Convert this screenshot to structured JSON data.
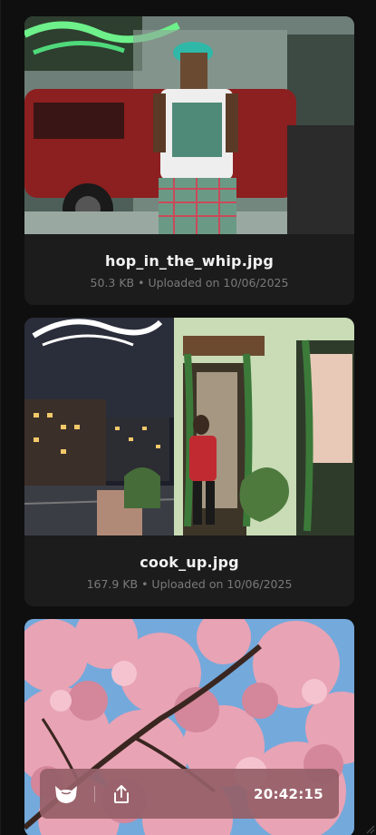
{
  "feed": {
    "items": [
      {
        "filename": "hop_in_the_whip.jpg",
        "meta": "50.3 KB • Uploaded on 10/06/2025"
      },
      {
        "filename": "cook_up.jpg",
        "meta": "167.9 KB • Uploaded on 10/06/2025"
      },
      {
        "filename": "",
        "meta": ""
      }
    ]
  },
  "toolbar": {
    "logo_icon": "cat-logo-icon",
    "share_icon": "share-icon",
    "time": "20:42:15"
  },
  "colors": {
    "background": "#0f0f0f",
    "card": "#1c1c1c",
    "toolbar": "#966068"
  }
}
